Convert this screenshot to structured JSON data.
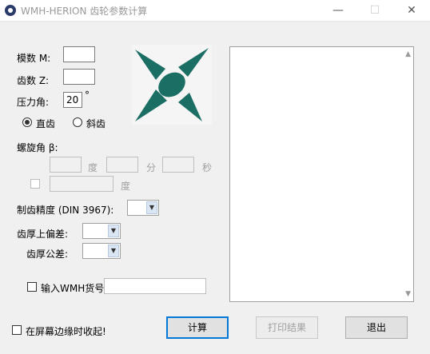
{
  "window": {
    "title": "WMH-HERION 齿轮参数计算",
    "min_glyph": "—",
    "max_glyph": "☐",
    "close_glyph": "✕"
  },
  "form": {
    "module_label": "模数 M:",
    "module_value": "",
    "teeth_label": "齿数 Z:",
    "teeth_value": "",
    "pressure_angle_label": "压力角:",
    "pressure_angle_value": "20",
    "degree_symbol": "°",
    "spur_label": "直齿",
    "helical_label": "斜齿",
    "selected_gear_type": "spur",
    "helix_label": "螺旋角 β:",
    "helix_degree_unit": "度",
    "helix_minute_unit": "分",
    "helix_second_unit": "秒",
    "helix_decimal_unit": "度",
    "precision_label": "制齿精度 (DIN 3967):",
    "tooth_upper_dev_label": "齿厚上偏差:",
    "tooth_tolerance_label": "齿厚公差:",
    "wmh_checkbox_label": "输入WMH货号",
    "wmh_value": ""
  },
  "bottom": {
    "collapse_label": "在屏幕边缘时收起!",
    "calc_button": "计算",
    "print_button": "打印结果",
    "exit_button": "退出"
  },
  "colors": {
    "logo": "#1a6e64",
    "accent": "#0078d7"
  },
  "icons": [
    "app-logo-icon",
    "brand-logo-icon",
    "scroll-up-icon",
    "scroll-down-icon",
    "combo-arrow-icon"
  ]
}
